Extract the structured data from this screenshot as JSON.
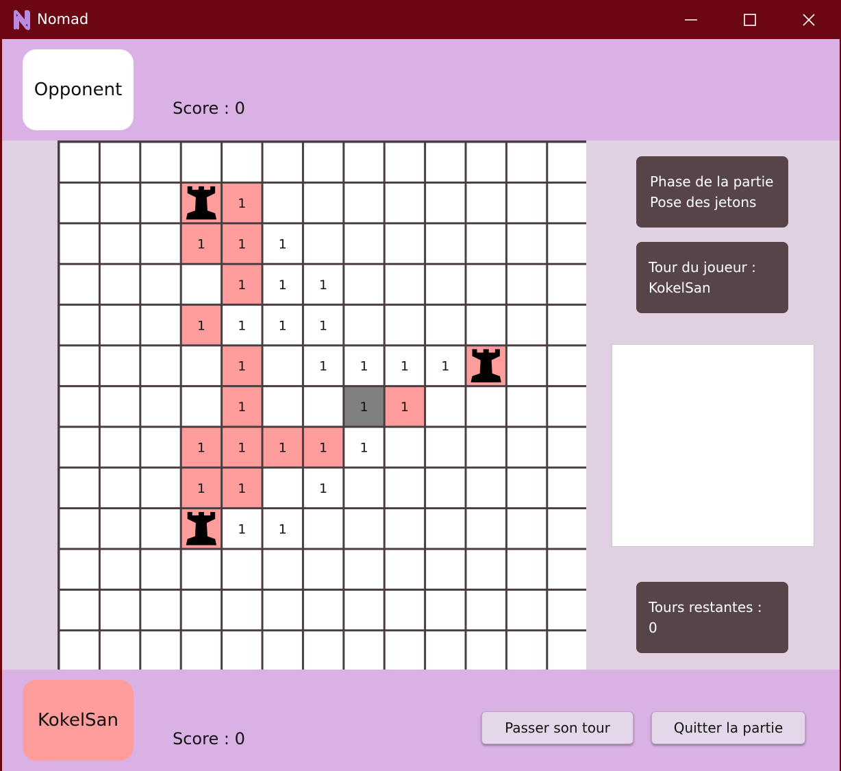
{
  "window": {
    "title": "Nomad",
    "logo_letter": "N"
  },
  "opponent": {
    "name": "Opponent",
    "score": "Score : 0"
  },
  "player": {
    "name": "KokelSan",
    "score": "Score : 0"
  },
  "colors": {
    "titlebar": "#6b0712",
    "player_zone": "#ff9d9d",
    "neutral_zone": "#ffffff",
    "selected_cell": "#808080",
    "grid_line": "#4a3d41",
    "info_box": "#564449",
    "band": "#d9b1e5",
    "middle": "#dfd0e2"
  },
  "board": {
    "rows": 13,
    "cols": 13,
    "cells": [
      {
        "r": 1,
        "c": 3,
        "type": "rook"
      },
      {
        "r": 1,
        "c": 4,
        "type": "pink",
        "label": "1"
      },
      {
        "r": 2,
        "c": 3,
        "type": "pink",
        "label": "1"
      },
      {
        "r": 2,
        "c": 4,
        "type": "pink",
        "label": "1"
      },
      {
        "r": 2,
        "c": 5,
        "type": "white",
        "label": "1"
      },
      {
        "r": 3,
        "c": 4,
        "type": "pink",
        "label": "1"
      },
      {
        "r": 3,
        "c": 5,
        "type": "white",
        "label": "1"
      },
      {
        "r": 3,
        "c": 6,
        "type": "white",
        "label": "1"
      },
      {
        "r": 4,
        "c": 3,
        "type": "pink",
        "label": "1"
      },
      {
        "r": 4,
        "c": 4,
        "type": "white",
        "label": "1"
      },
      {
        "r": 4,
        "c": 5,
        "type": "white",
        "label": "1"
      },
      {
        "r": 4,
        "c": 6,
        "type": "white",
        "label": "1"
      },
      {
        "r": 5,
        "c": 4,
        "type": "pink",
        "label": "1"
      },
      {
        "r": 5,
        "c": 6,
        "type": "white",
        "label": "1"
      },
      {
        "r": 5,
        "c": 7,
        "type": "white",
        "label": "1"
      },
      {
        "r": 5,
        "c": 8,
        "type": "white",
        "label": "1"
      },
      {
        "r": 5,
        "c": 9,
        "type": "white",
        "label": "1"
      },
      {
        "r": 5,
        "c": 10,
        "type": "rook"
      },
      {
        "r": 6,
        "c": 4,
        "type": "pink",
        "label": "1"
      },
      {
        "r": 6,
        "c": 7,
        "type": "gray",
        "label": "1"
      },
      {
        "r": 6,
        "c": 8,
        "type": "pink",
        "label": "1"
      },
      {
        "r": 7,
        "c": 3,
        "type": "pink",
        "label": "1"
      },
      {
        "r": 7,
        "c": 4,
        "type": "pink",
        "label": "1"
      },
      {
        "r": 7,
        "c": 5,
        "type": "pink",
        "label": "1"
      },
      {
        "r": 7,
        "c": 6,
        "type": "pink",
        "label": "1"
      },
      {
        "r": 7,
        "c": 7,
        "type": "white",
        "label": "1"
      },
      {
        "r": 8,
        "c": 3,
        "type": "pink",
        "label": "1"
      },
      {
        "r": 8,
        "c": 4,
        "type": "pink",
        "label": "1"
      },
      {
        "r": 8,
        "c": 6,
        "type": "white",
        "label": "1"
      },
      {
        "r": 9,
        "c": 3,
        "type": "rook"
      },
      {
        "r": 9,
        "c": 4,
        "type": "white",
        "label": "1"
      },
      {
        "r": 9,
        "c": 5,
        "type": "white",
        "label": "1"
      }
    ]
  },
  "info": {
    "phase_title": "Phase de la partie",
    "phase_value": "Pose des jetons",
    "turn_title": "Tour du joueur :",
    "turn_value": "KokelSan",
    "remaining_title": "Tours restantes :",
    "remaining_value": "0"
  },
  "buttons": {
    "pass": "Passer son tour",
    "quit": "Quitter la partie"
  }
}
